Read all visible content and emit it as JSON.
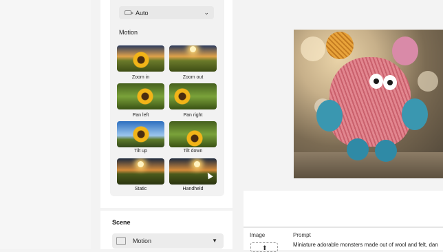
{
  "video_settings": {
    "camera_select_value": "Auto"
  },
  "motion": {
    "title": "Motion",
    "options": [
      {
        "label": "Zoom in"
      },
      {
        "label": "Zoom out"
      },
      {
        "label": "Pan left"
      },
      {
        "label": "Pan right"
      },
      {
        "label": "Tilt up"
      },
      {
        "label": "Tilt down"
      },
      {
        "label": "Static"
      },
      {
        "label": "Handheld"
      }
    ]
  },
  "scene": {
    "title": "Scene",
    "select_value": "Motion"
  },
  "bottom_bar": {
    "image_label": "Image",
    "prompt_label": "Prompt",
    "prompt_text": "Miniature adorable monsters made out of wool and felt, dan"
  },
  "icons": {
    "camera": "video-camera-icon",
    "chevron": "chevron-down-icon",
    "upload": "upload-icon"
  }
}
